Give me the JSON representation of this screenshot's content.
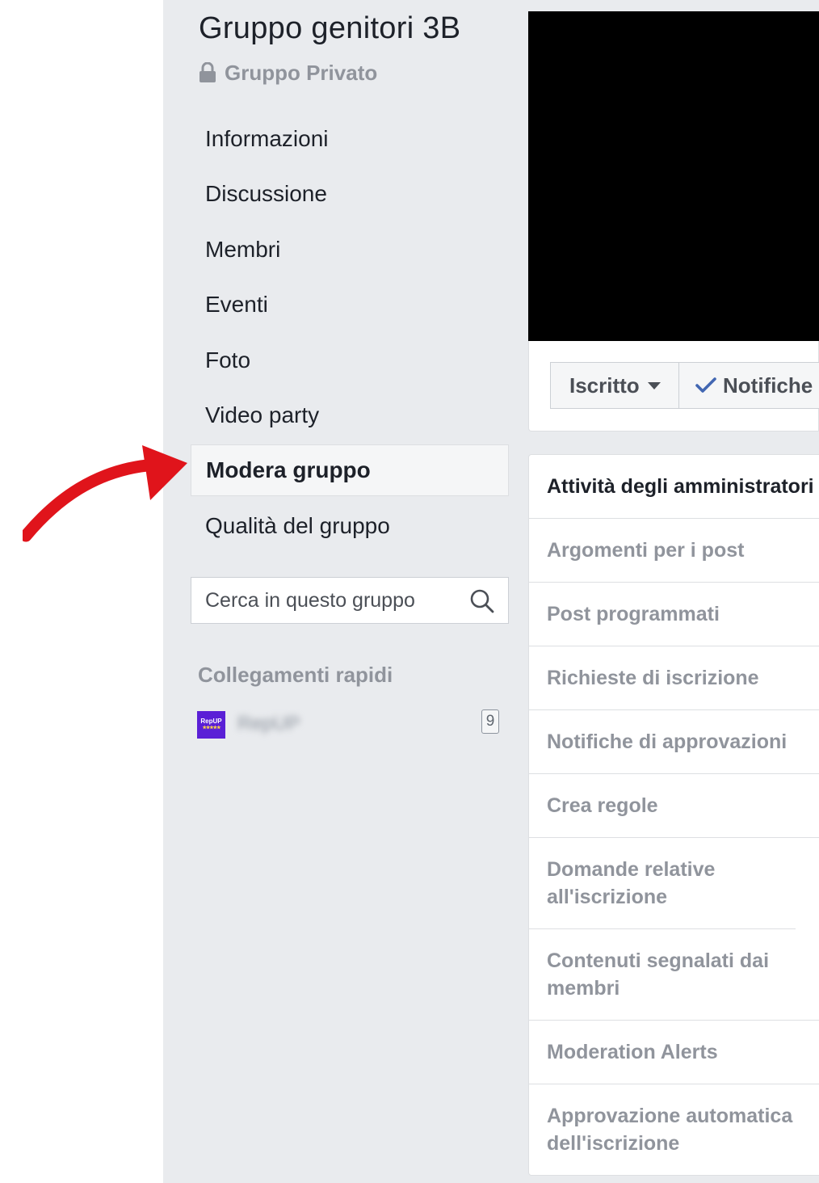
{
  "group": {
    "title": "Gruppo genitori 3B",
    "privacy": "Gruppo Privato"
  },
  "nav": {
    "items": [
      {
        "label": "Informazioni",
        "active": false
      },
      {
        "label": "Discussione",
        "active": false
      },
      {
        "label": "Membri",
        "active": false
      },
      {
        "label": "Eventi",
        "active": false
      },
      {
        "label": "Foto",
        "active": false
      },
      {
        "label": "Video party",
        "active": false
      },
      {
        "label": "Modera gruppo",
        "active": true
      },
      {
        "label": "Qualità del gruppo",
        "active": false
      }
    ]
  },
  "search": {
    "placeholder": "Cerca in questo gruppo"
  },
  "quick_links": {
    "title": "Collegamenti rapidi",
    "items": [
      {
        "logo_text": "RepUP",
        "label": "RepUP",
        "count": "9"
      }
    ]
  },
  "actions": {
    "joined_label": "Iscritto",
    "notifications_label": "Notifiche"
  },
  "admin": {
    "items": [
      {
        "label": "Attività degli amministratori"
      },
      {
        "label": "Argomenti per i post"
      },
      {
        "label": "Post programmati"
      },
      {
        "label": "Richieste di iscrizione"
      },
      {
        "label": "Notifiche di approvazioni"
      },
      {
        "label": "Crea regole"
      },
      {
        "label": "Domande relative all'iscrizione"
      },
      {
        "label": "Contenuti segnalati dai membri"
      },
      {
        "label": "Moderation Alerts"
      },
      {
        "label": "Approvazione automatica dell'iscrizione"
      }
    ]
  },
  "colors": {
    "accent": "#4267b2",
    "arrow": "#e0141b",
    "sidebar_bg": "#e9ebee",
    "muted_text": "#90949c"
  }
}
